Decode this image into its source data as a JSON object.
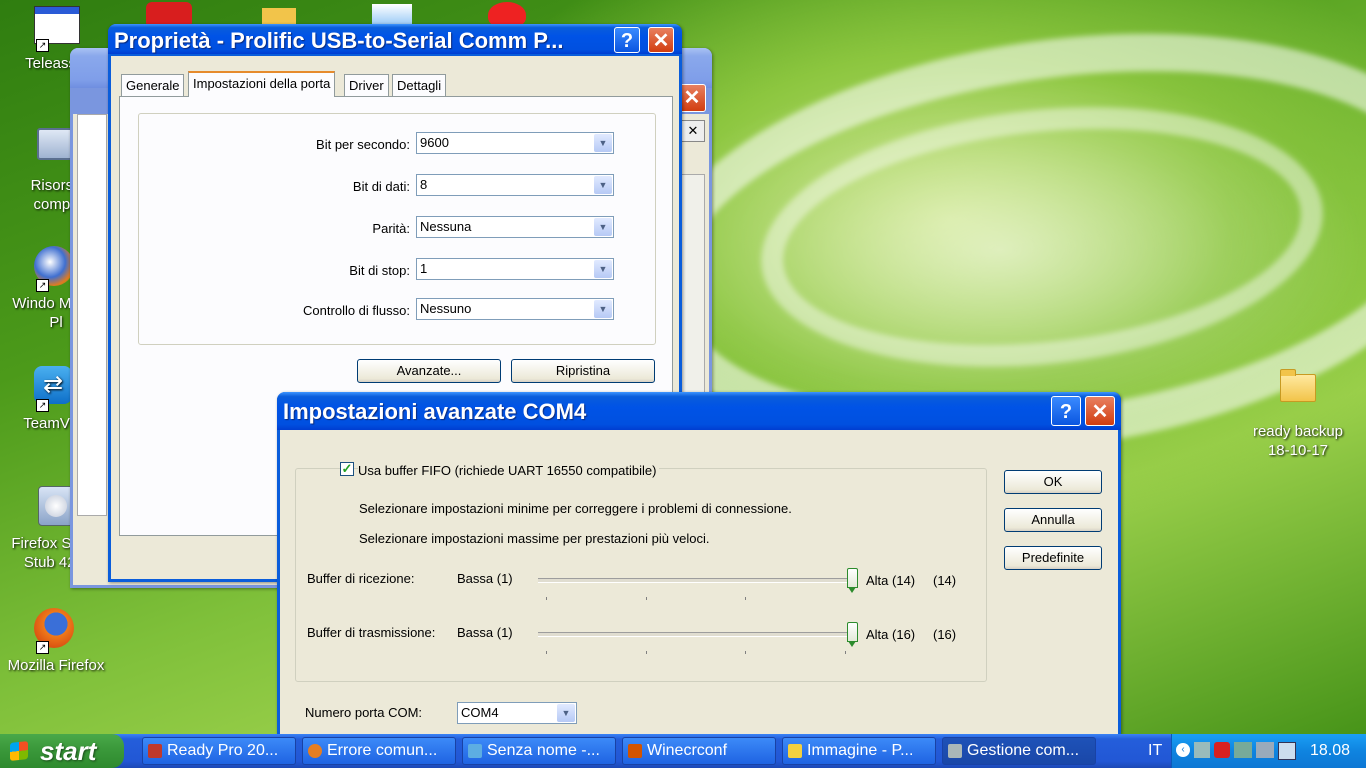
{
  "desktop": {
    "icons": [
      {
        "label": "Teleassis",
        "kind": "window"
      },
      {
        "label": "Risorse compu",
        "kind": "computer"
      },
      {
        "label": "Windo Media Pl",
        "kind": "media"
      },
      {
        "label": "TeamViev",
        "kind": "teamviewer"
      },
      {
        "label": "Firefox Setup Stub 42.0",
        "kind": "setup"
      },
      {
        "label": "Mozilla Firefox",
        "kind": "firefox"
      },
      {
        "label": "ready backup 18-10-17",
        "kind": "folder"
      }
    ]
  },
  "props_window": {
    "title": "Proprietà - Prolific USB-to-Serial Comm P...",
    "help": "?",
    "close": "✕",
    "tabs": [
      "Generale",
      "Impostazioni della porta",
      "Driver",
      "Dettagli"
    ],
    "fields": [
      {
        "label": "Bit per secondo:",
        "value": "9600"
      },
      {
        "label": "Bit di dati:",
        "value": "8"
      },
      {
        "label": "Parità:",
        "value": "Nessuna"
      },
      {
        "label": "Bit di stop:",
        "value": "1"
      },
      {
        "label": "Controllo di flusso:",
        "value": "Nessuno"
      }
    ],
    "advanced_button": "Avanzate...",
    "restore_button": "Ripristina"
  },
  "adv_dialog": {
    "title": "Impostazioni avanzate COM4",
    "help": "?",
    "close": "✕",
    "fifo_label": "Usa buffer FIFO (richiede UART 16550 compatibile)",
    "fifo_checked": true,
    "hint_min": "Selezionare impostazioni minime per correggere i problemi di connessione.",
    "hint_max": "Selezionare impostazioni massime per prestazioni più veloci.",
    "receive": {
      "label": "Buffer di ricezione:",
      "low": "Bassa (1)",
      "high": "Alta (14)",
      "current": "(14)",
      "value": 14,
      "min": 1,
      "max": 14
    },
    "transmit": {
      "label": "Buffer di trasmissione:",
      "low": "Bassa (1)",
      "high": "Alta (16)",
      "current": "(16)",
      "value": 16,
      "min": 1,
      "max": 16
    },
    "com_label": "Numero porta COM:",
    "com_value": "COM4",
    "ok": "OK",
    "cancel": "Annulla",
    "defaults": "Predefinite"
  },
  "taskbar": {
    "start": "start",
    "tasks": [
      {
        "label": "Ready Pro 20...",
        "color": "#c0392b"
      },
      {
        "label": "Errore comun...",
        "color": "#e67e22"
      },
      {
        "label": "Senza nome -...",
        "color": "#5dade2"
      },
      {
        "label": "Winecrconf",
        "color": "#d35400"
      },
      {
        "label": "Immagine - P...",
        "color": "#f4d03f"
      },
      {
        "label": "Gestione com...",
        "color": "#aab7b8"
      }
    ],
    "language": "IT",
    "clock": "18.08"
  }
}
